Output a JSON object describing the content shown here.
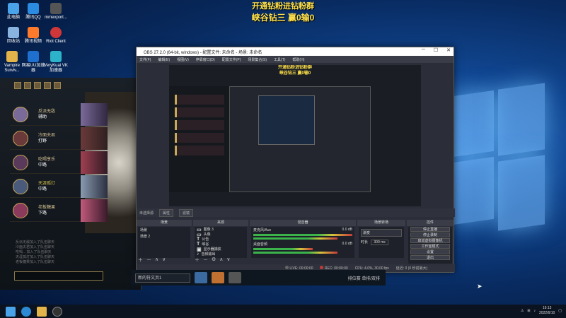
{
  "stream_overlay": {
    "line1": "开通钻粉进钻粉群",
    "line2": "峡谷钻三 赢0输0"
  },
  "desktop_icons": [
    {
      "name": "此电脑",
      "color": "#4aa3e8"
    },
    {
      "name": "腾讯QQ",
      "color": "#2a8be0"
    },
    {
      "name": "mmexport...",
      "color": "#666"
    },
    {
      "name": "回收站",
      "color": "#8ab4e0"
    },
    {
      "name": "腾讯视频",
      "color": "#ff7a2b"
    },
    {
      "name": "Riot Client",
      "color": "#d13639"
    },
    {
      "name": "Vampire Surviv...",
      "color": "#e3b44a"
    },
    {
      "name": "网易UU加速器",
      "color": "#1f6fcf"
    },
    {
      "name": "VeryKuai VK 加速器",
      "color": "#2cb3c9"
    }
  ],
  "lol": {
    "players": [
      {
        "name": "反派无敌",
        "role": "辅助",
        "color": "#7a6a9a"
      },
      {
        "name": "冷面夫君",
        "role": "打野",
        "color": "#6a3a3a"
      },
      {
        "name": "吃喝享乐",
        "role": "中路",
        "color": "#5a3a5a"
      },
      {
        "name": "天涯孤灯",
        "role": "中路",
        "color": "#4a5a7a"
      },
      {
        "name": "老板糖果",
        "role": "下路",
        "color": "#8a3a5a"
      }
    ],
    "chat_lines": [
      "反派无敌加入了队伍聊天",
      "冷面夫君加入了队伍聊天",
      "吃喝... 加入了队伍聊天",
      "天涯孤灯加入了队伍聊天",
      "老板糖果加入了队伍聊天"
    ]
  },
  "obs": {
    "title": "OBS 27.2.0 (64-bit, windows) - 配置文件: 未命名 - 场景: 未命名",
    "menu": [
      "文件(F)",
      "编辑(E)",
      "视图(V)",
      "停靠窗口(D)",
      "配置文件(P)",
      "场景集合(S)",
      "工具(T)",
      "帮助(H)"
    ],
    "source_bar": {
      "label": "未选择源",
      "props": "属性",
      "filters": "滤镜"
    },
    "docks": {
      "scenes": {
        "title": "场景",
        "items": [
          "场景",
          "场景 2"
        ]
      },
      "sources": {
        "title": "来源",
        "items": [
          "图像 3",
          "头像",
          "公告",
          "峡谷",
          "显示器捕获",
          "音频输出"
        ]
      },
      "mixer": {
        "title": "混音器",
        "tracks": [
          {
            "name": "麦克风/Aux",
            "db": "0.0 dB"
          },
          {
            "name": "桌面音频",
            "db": "0.0 dB"
          }
        ]
      },
      "transitions": {
        "title": "场景转场",
        "type": "渐变",
        "duration_label": "时长",
        "duration": "300 ms"
      },
      "controls": {
        "title": "控件",
        "buttons": [
          "停止直播",
          "停止录制",
          "启动虚拟摄像机",
          "工作室模式",
          "设置",
          "退出"
        ]
      }
    },
    "status": {
      "live": "LIVE: 00:00:00",
      "rec": "REC: 00:00:00",
      "cpu": "CPU: 4.0%, 30.00 fps",
      "disk": "延迟: 0 (0 秒前最大)"
    }
  },
  "bottom_strip": {
    "select": "新的符文页1",
    "rank": "排位赛 单排/双排"
  },
  "taskbar": {
    "time": "19:13",
    "date": "2022/6/10"
  }
}
